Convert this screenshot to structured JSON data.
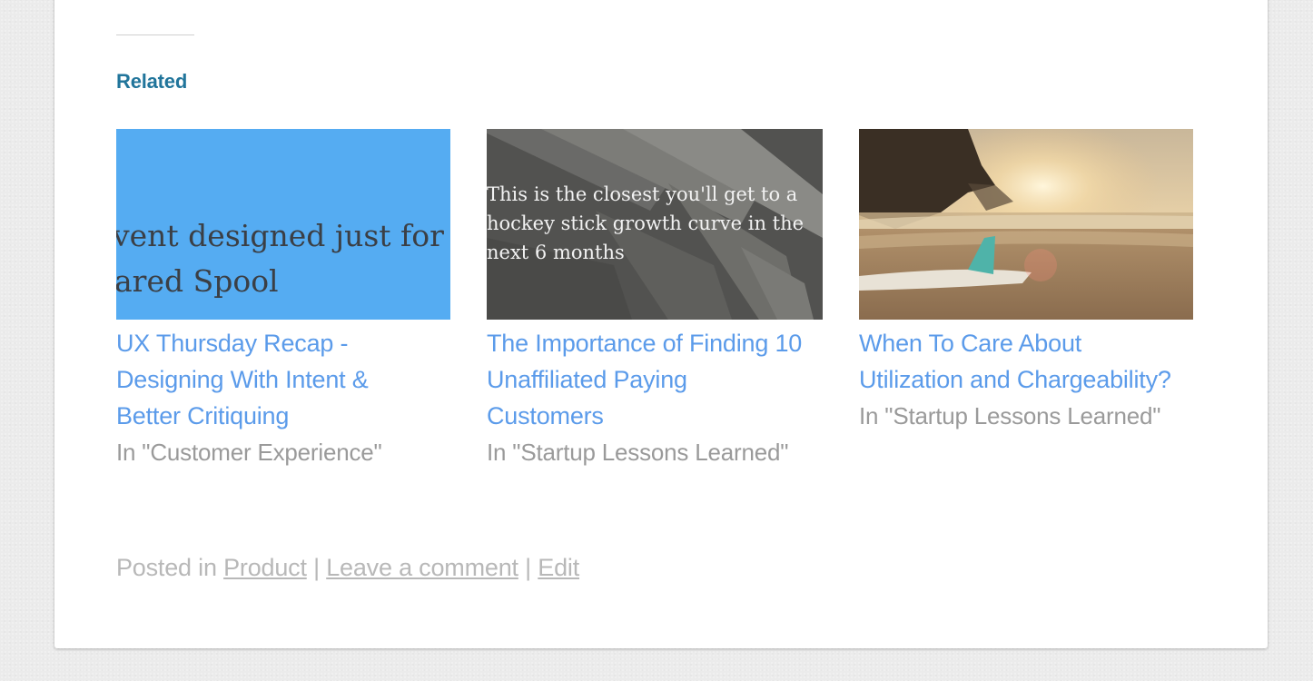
{
  "related": {
    "heading": "Related",
    "items": [
      {
        "thumb_lines": [
          "vent designed just for user",
          "ared Spool"
        ],
        "title": "UX Thursday Recap - Designing With Intent & Better Critiquing",
        "title_lines": [
          "UX Thursday Recap -",
          "Designing With Intent &",
          "Better Critiquing"
        ],
        "context": "In \"Customer Experience\""
      },
      {
        "thumb_lines": [
          "This is the closest you'll get to a",
          "hockey stick growth curve in the",
          "next 6 months"
        ],
        "title": "The Importance of Finding 10 Unaffiliated Paying Customers",
        "title_lines": [
          "The Importance of Finding 10",
          "Unaffiliated Paying",
          "Customers"
        ],
        "context": "In \"Startup Lessons Learned\""
      },
      {
        "title": "When To Care About Utilization and Chargeability?",
        "title_lines": [
          "When To Care About",
          "Utilization and Chargeability?"
        ],
        "context": "In \"Startup Lessons Learned\""
      }
    ]
  },
  "footer": {
    "posted_in_label": "Posted in",
    "category": "Product",
    "separator": "|",
    "leave_comment": "Leave a comment",
    "edit": "Edit"
  },
  "colors": {
    "heading": "#21759b",
    "link": "#5b9bea",
    "meta": "#9a9a9a",
    "footer": "#b8b8b8",
    "thumb1_bg": "#55acf2"
  }
}
